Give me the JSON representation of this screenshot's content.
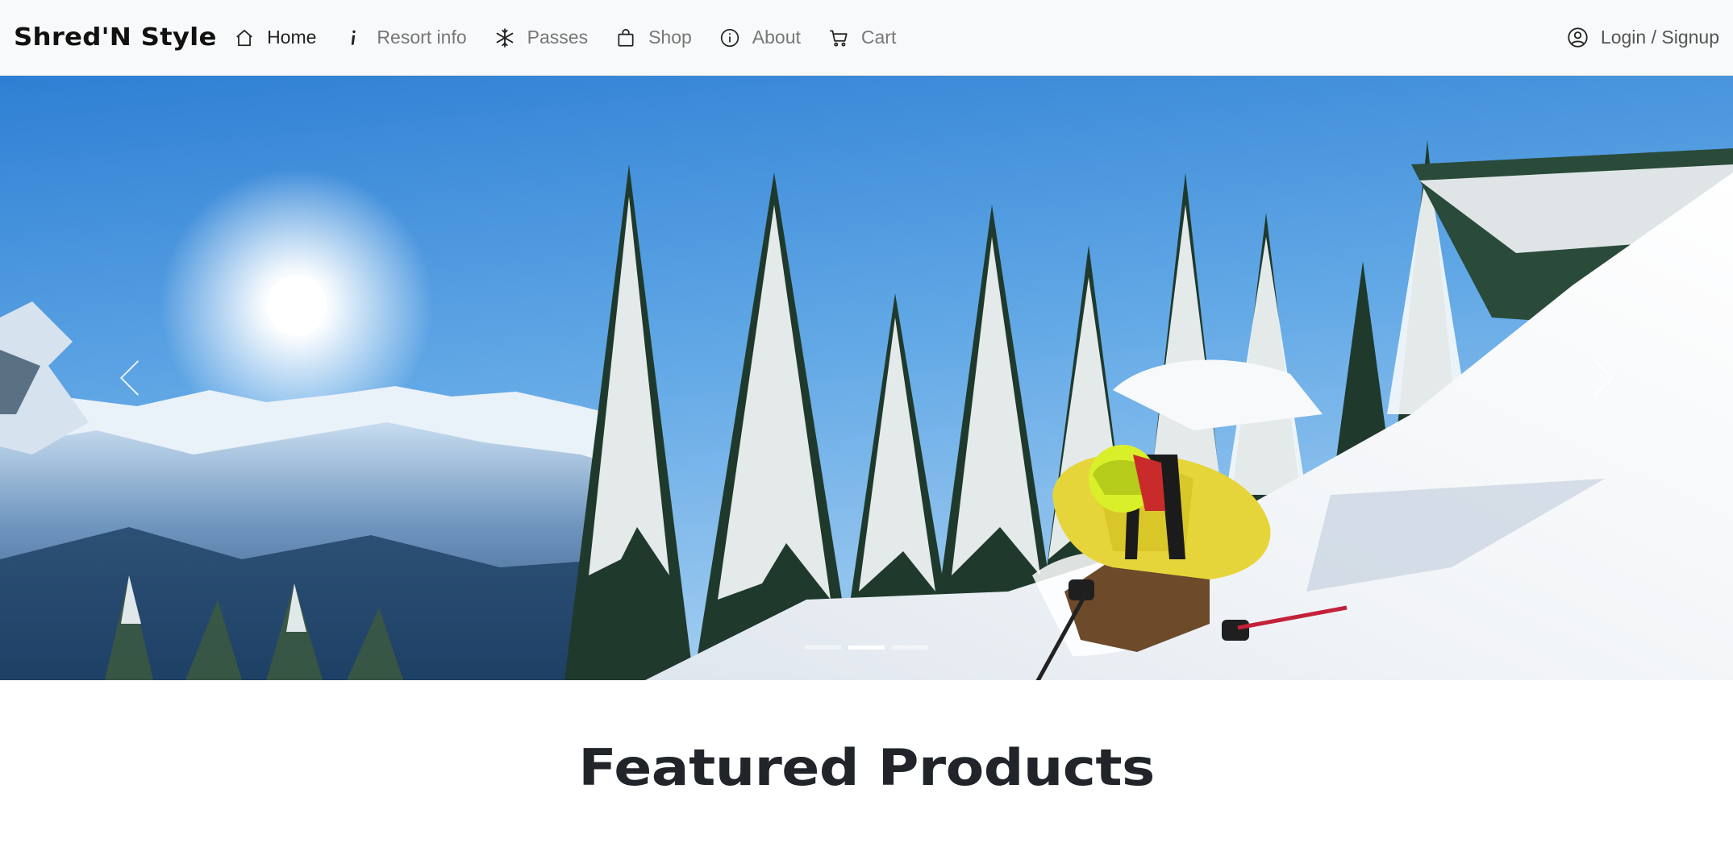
{
  "brand": "Shred'N Style",
  "nav": {
    "items": [
      {
        "label": "Home",
        "icon": "home-icon",
        "active": true
      },
      {
        "label": "Resort info",
        "icon": "info-icon",
        "active": false
      },
      {
        "label": "Passes",
        "icon": "snowflake-icon",
        "active": false
      },
      {
        "label": "Shop",
        "icon": "shopping-bag-icon",
        "active": false
      },
      {
        "label": "About",
        "icon": "info-circle-icon",
        "active": false
      },
      {
        "label": "Cart",
        "icon": "cart-icon",
        "active": false
      }
    ],
    "account": {
      "label": "Login / Signup",
      "icon": "user-circle-icon"
    }
  },
  "carousel": {
    "slide_image": "skier-in-deep-powder-photo",
    "slide_count": 3,
    "active_index": 1,
    "controls": [
      "carousel-prev-icon",
      "carousel-next-icon"
    ]
  },
  "featured": {
    "title": "Featured Products"
  },
  "colors": {
    "navbar_bg": "#f8f9fa",
    "text_dark": "#212529",
    "nav_inactive": "#777777"
  }
}
